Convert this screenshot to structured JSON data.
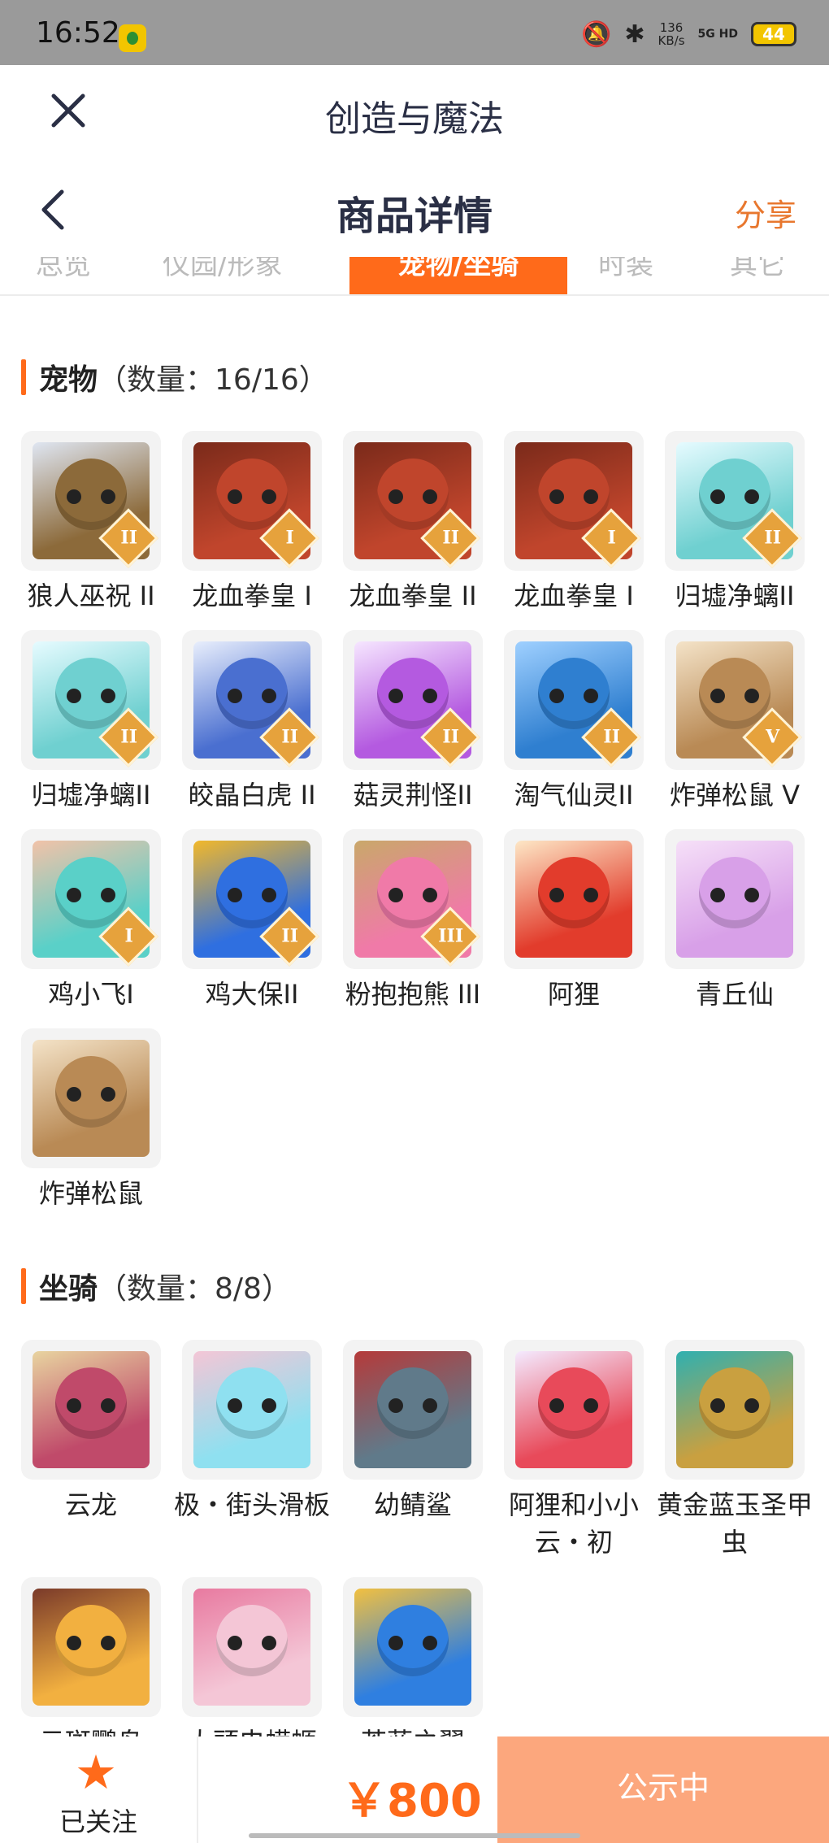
{
  "status_bar": {
    "time": "16:52",
    "net_speed": "136",
    "net_unit": "KB/s",
    "network": "5G HD",
    "battery": "44"
  },
  "topbar": {
    "title": "创造与魔法"
  },
  "navbar": {
    "title": "商品详情",
    "share_label": "分享"
  },
  "tabs": [
    {
      "label": "总览"
    },
    {
      "label": "仪园/形象"
    },
    {
      "label": "宠物/坐骑"
    },
    {
      "label": "时装"
    },
    {
      "label": "其它"
    }
  ],
  "pets": {
    "name": "宠物",
    "count": "（数量：16/16）",
    "items": [
      {
        "label": "狼人巫祝 II",
        "tier": "II",
        "color": "#8c6a3a",
        "accent": "#dfe6f2"
      },
      {
        "label": "龙血拳皇 I",
        "tier": "I",
        "color": "#c0452c",
        "accent": "#7a2a1a"
      },
      {
        "label": "龙血拳皇 II",
        "tier": "II",
        "color": "#c0452c",
        "accent": "#7a2a1a"
      },
      {
        "label": "龙血拳皇 I",
        "tier": "I",
        "color": "#c0452c",
        "accent": "#7a2a1a"
      },
      {
        "label": "归墟净螭II",
        "tier": "II",
        "color": "#6fd0d0",
        "accent": "#e6fbff"
      },
      {
        "label": "归墟净螭II",
        "tier": "II",
        "color": "#6fd0d0",
        "accent": "#e6fbff"
      },
      {
        "label": "皎晶白虎 II",
        "tier": "II",
        "color": "#4a6fd0",
        "accent": "#e8eefc"
      },
      {
        "label": "菇灵荆怪II",
        "tier": "II",
        "color": "#b45ae0",
        "accent": "#f6e6ff"
      },
      {
        "label": "淘气仙灵II",
        "tier": "II",
        "color": "#2f7fd0",
        "accent": "#9fd0ff"
      },
      {
        "label": "炸弹松鼠 V",
        "tier": "V",
        "color": "#b98a55",
        "accent": "#f4e3c8"
      },
      {
        "label": "鸡小飞I",
        "tier": "I",
        "color": "#5ad0c8",
        "accent": "#f2c2a8"
      },
      {
        "label": "鸡大保II",
        "tier": "II",
        "color": "#2f6fe0",
        "accent": "#f2b82a"
      },
      {
        "label": "粉抱抱熊 III",
        "tier": "III",
        "color": "#f07aa8",
        "accent": "#c9a86a"
      },
      {
        "label": "阿狸",
        "tier": "",
        "color": "#e23c2c",
        "accent": "#fde7c6"
      },
      {
        "label": "青丘仙",
        "tier": "",
        "color": "#d8a0e8",
        "accent": "#f6e0f8"
      },
      {
        "label": "炸弹松鼠",
        "tier": "",
        "color": "#b98a55",
        "accent": "#f4e3c8"
      }
    ]
  },
  "mounts": {
    "name": "坐骑",
    "count": "（数量：8/8）",
    "items": [
      {
        "label": "云龙",
        "color": "#c04a6a",
        "accent": "#e8d4a0"
      },
      {
        "label": "极・街头滑板",
        "color": "#8fe0f0",
        "accent": "#f4c6d6"
      },
      {
        "label": "幼鲭鲨",
        "color": "#607a8a",
        "accent": "#b53a3a"
      },
      {
        "label": "阿狸和小小云・初",
        "color": "#e84a5a",
        "accent": "#f4eaff"
      },
      {
        "label": "黄金蓝玉圣甲虫",
        "color": "#c9a040",
        "accent": "#2fb0b0"
      },
      {
        "label": "云斑鹦鸟",
        "color": "#f2b040",
        "accent": "#7a3a2a"
      },
      {
        "label": "大頭电蝾螈",
        "color": "#f4c6d6",
        "accent": "#e87aa0"
      },
      {
        "label": "苍蓝之翼",
        "color": "#2f7fe0",
        "accent": "#f2c040"
      }
    ]
  },
  "bottom": {
    "follow_label": "已关注",
    "price": "￥800",
    "status_label": "公示中"
  },
  "colors": {
    "accent": "#ff6a1a",
    "button": "#fca77d",
    "title": "#2a2f45"
  }
}
